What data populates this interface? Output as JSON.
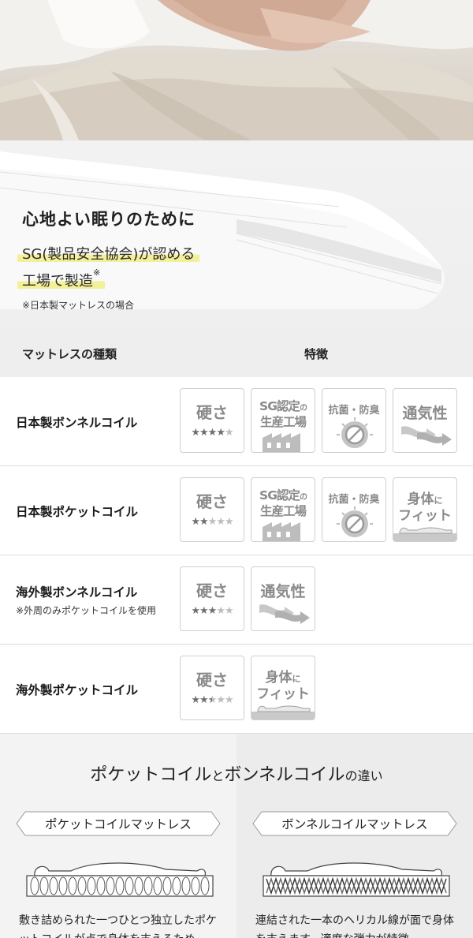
{
  "banner": {
    "title": "心地よい眠りのために",
    "line1": "SG(製品安全協会)が認める",
    "line2": "工場で製造",
    "line2_mark": "※",
    "note": "※日本製マットレスの場合"
  },
  "table": {
    "header": {
      "type": "マットレスの種類",
      "features": "特徴"
    },
    "labels": {
      "hardness": "硬さ",
      "sg_a": "SG認定",
      "sg_a_small": "の",
      "sg_b": "生産工場",
      "antibac": "抗菌・防臭",
      "breath": "通気性",
      "fit_a": "身体",
      "fit_a_small": "に",
      "fit_b": "フィット"
    },
    "rows": [
      {
        "name": "日本製ボンネルコイル",
        "sub": "",
        "hardness_stars": 4,
        "stars_total": 5
      },
      {
        "name": "日本製ポケットコイル",
        "sub": "",
        "hardness_stars": 2,
        "stars_total": 5
      },
      {
        "name": "海外製ボンネルコイル",
        "sub": "※外周のみポケットコイルを使用",
        "hardness_stars": 3,
        "stars_total": 5
      },
      {
        "name": "海外製ポケットコイル",
        "sub": "",
        "hardness_stars": 2.5,
        "stars_total": 5
      }
    ]
  },
  "difference": {
    "title_a": "ポケットコイル",
    "title_b": "と",
    "title_c": "ボンネルコイル",
    "title_d": "の違い",
    "pocket": {
      "label": "ポケットコイルマットレス",
      "text": "敷き詰められた一つひとつ独立したポケットコイルが点で身体を支えるため"
    },
    "bonnell": {
      "label": "ボンネルコイルマットレス",
      "text": "連結された一本のヘリカル線が面で身体を支えます。適度な弾力が特徴"
    }
  },
  "colors": {
    "highlight": "#f3f09a",
    "badge_text": "#8a8a8a",
    "star_on": "#707070",
    "star_off": "#bdbdbd"
  }
}
